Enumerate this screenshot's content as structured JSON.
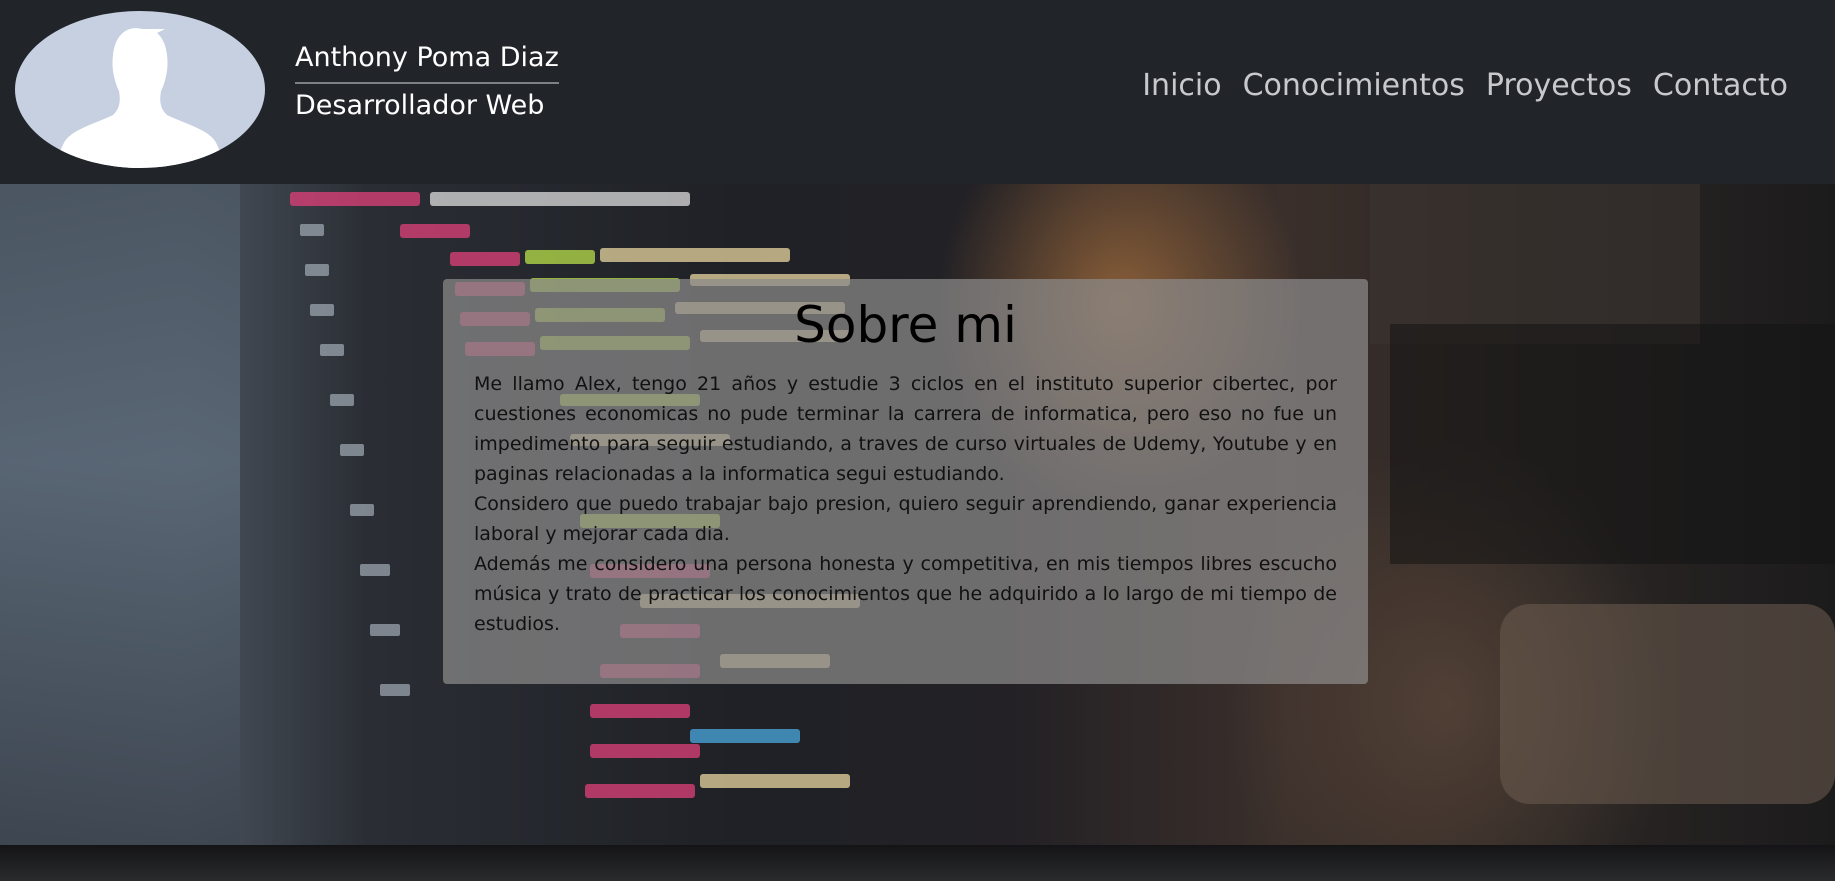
{
  "header": {
    "avatar_icon": "user-silhouette-icon",
    "name": "Anthony Poma Diaz",
    "role": "Desarrollador Web",
    "nav": [
      {
        "label": "Inicio"
      },
      {
        "label": "Conocimientos"
      },
      {
        "label": "Proyectos"
      },
      {
        "label": "Contacto"
      }
    ]
  },
  "about": {
    "title": "Sobre mi",
    "paragraphs": [
      "Me llamo Alex, tengo 21 años y estudie 3 ciclos en el instituto superior cibertec, por cuestiones economicas no pude terminar la carrera de informatica, pero eso no fue un impedimento para seguir estudiando, a traves de curso virtuales de Udemy, Youtube y en paginas relacionadas a la informatica segui estudiando.",
      "Considero que puedo trabajar bajo presion, quiero seguir aprendiendo, ganar experiencia laboral y mejorar cada dia.",
      "Además me considero una persona honesta y competitiva, en mis tiempos libres escucho música y trato de practicar los conocimientos que he adquirido a lo largo de mi tiempo de estudios."
    ]
  },
  "colors": {
    "header_bg": "#212429",
    "avatar_bg": "#c6d0e1",
    "nav_text": "#c7c9cc",
    "card_bg": "rgba(140,138,138,0.72)"
  }
}
